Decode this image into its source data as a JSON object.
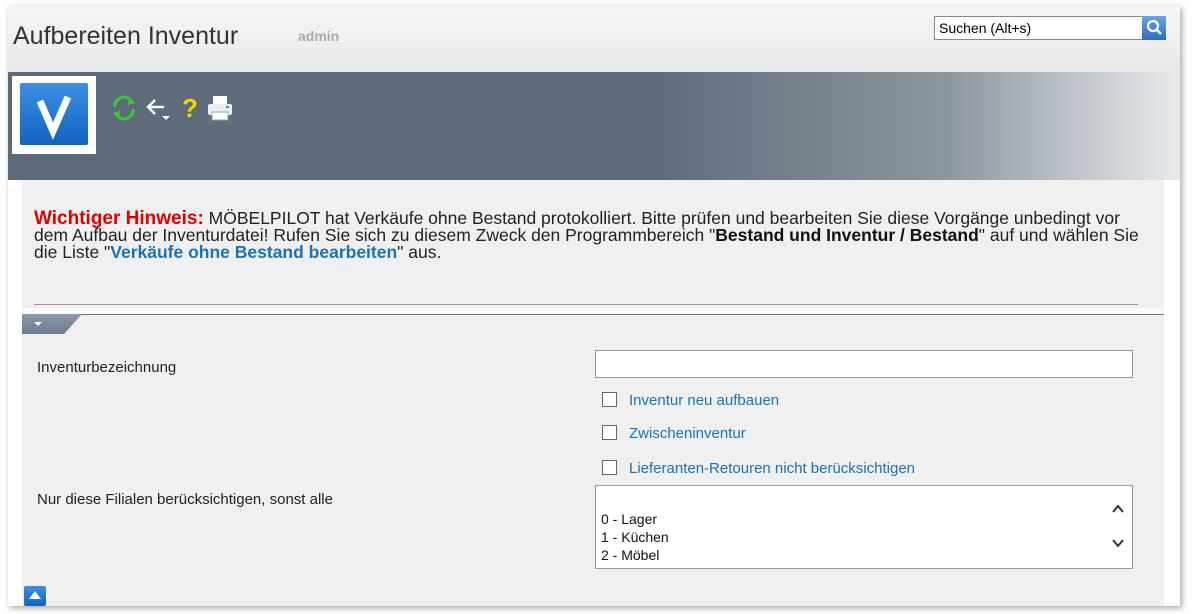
{
  "header": {
    "title": "Aufbereiten Inventur",
    "user": "admin",
    "search_value": "Suchen (Alt+s)"
  },
  "toolbar": {
    "icons": [
      "check-icon",
      "refresh-icon",
      "back-icon",
      "help-icon",
      "print-icon"
    ],
    "colors": {
      "accent": "#1a73b8",
      "warning": "#e00000",
      "toolbar_bg": "#5e6c7a"
    }
  },
  "notice": {
    "warning_label": "Wichtiger Hinweis:",
    "text_1": " MÖBELPILOT hat Verkäufe ohne Bestand protokolliert. Bitte prüfen und bearbeiten Sie diese Vorgänge unbedingt vor dem Aufbau der Inventurdatei! Rufen Sie sich zu diesem Zweck den Programmbereich \"",
    "bold_area": "Bestand und Inventur / Bestand",
    "text_2": "\" auf und wählen Sie die Liste \"",
    "link_list": "Verkäufe ohne Bestand bearbeiten",
    "text_3": "\" aus."
  },
  "form": {
    "inventory_label": "Inventurbezeichnung",
    "inventory_value": "",
    "checkbox_rebuild": "Inventur neu aufbauen",
    "checkbox_interim": "Zwischeninventur",
    "checkbox_returns": "Lieferanten-Retouren nicht berücksichtigen",
    "branches_label": "Nur diese Filialen berücksichtigen, sonst alle",
    "branches": [
      "0 - Lager",
      "1 - Küchen",
      "2 - Möbel"
    ]
  }
}
